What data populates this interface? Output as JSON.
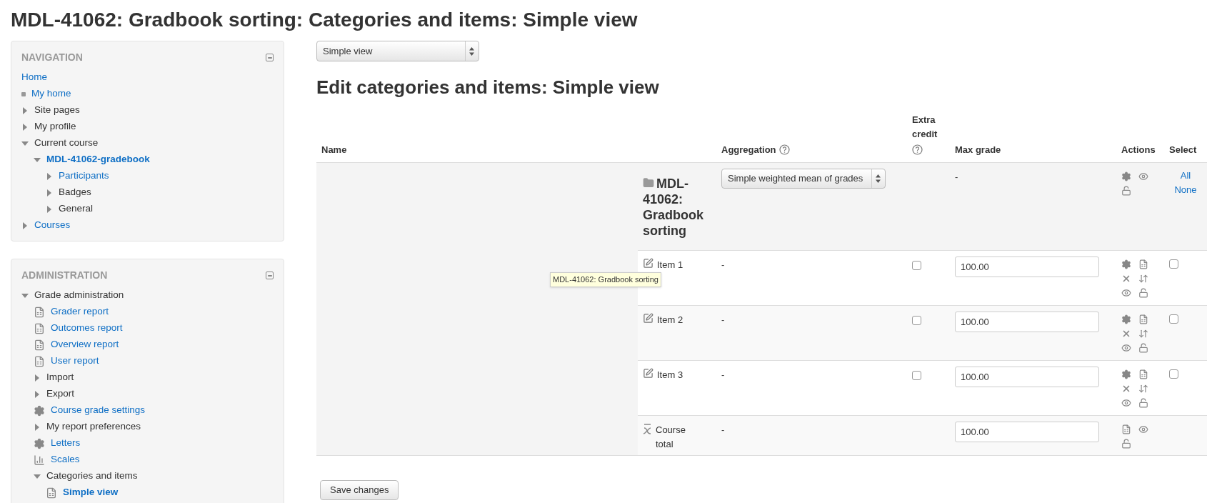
{
  "page_title": "MDL-41062: Gradbook sorting: Categories and items: Simple view",
  "blocks": [
    {
      "title": "NAVIGATION",
      "items": [
        {
          "label": "Home",
          "kind": "plain",
          "link": true,
          "current": false
        },
        {
          "label": "My home",
          "kind": "bullet",
          "link": true,
          "current": false
        },
        {
          "label": "Site pages",
          "kind": "branch",
          "expanded": false,
          "link": false,
          "current": false
        },
        {
          "label": "My profile",
          "kind": "branch",
          "expanded": false,
          "link": false,
          "current": false
        },
        {
          "label": "Current course",
          "kind": "branch",
          "expanded": true,
          "link": false,
          "current": false,
          "children": [
            {
              "label": "MDL-41062-gradebook",
              "kind": "branch",
              "expanded": true,
              "link": true,
              "current": true,
              "children": [
                {
                  "label": "Participants",
                  "kind": "branch",
                  "expanded": false,
                  "link": true,
                  "current": false
                },
                {
                  "label": "Badges",
                  "kind": "branch",
                  "expanded": false,
                  "link": false,
                  "current": false
                },
                {
                  "label": "General",
                  "kind": "branch",
                  "expanded": false,
                  "link": false,
                  "current": false
                }
              ]
            }
          ]
        },
        {
          "label": "Courses",
          "kind": "branch",
          "expanded": false,
          "link": true,
          "current": false
        }
      ]
    },
    {
      "title": "ADMINISTRATION",
      "items": [
        {
          "label": "Grade administration",
          "kind": "branch",
          "expanded": true,
          "link": false,
          "current": false,
          "children": [
            {
              "label": "Grader report",
              "kind": "report",
              "link": true,
              "current": false
            },
            {
              "label": "Outcomes report",
              "kind": "report",
              "link": true,
              "current": false
            },
            {
              "label": "Overview report",
              "kind": "report",
              "link": true,
              "current": false
            },
            {
              "label": "User report",
              "kind": "report",
              "link": true,
              "current": false
            },
            {
              "label": "Import",
              "kind": "branch",
              "expanded": false,
              "link": false,
              "current": false
            },
            {
              "label": "Export",
              "kind": "branch",
              "expanded": false,
              "link": false,
              "current": false
            },
            {
              "label": "Course grade settings",
              "kind": "gear",
              "link": true,
              "current": false
            },
            {
              "label": "My report preferences",
              "kind": "branch",
              "expanded": false,
              "link": false,
              "current": false
            },
            {
              "label": "Letters",
              "kind": "gear",
              "link": true,
              "current": false
            },
            {
              "label": "Scales",
              "kind": "chart",
              "link": true,
              "current": false
            },
            {
              "label": "Categories and items",
              "kind": "branch",
              "expanded": true,
              "link": false,
              "current": false,
              "children": [
                {
                  "label": "Simple view",
                  "kind": "report",
                  "link": true,
                  "current": true
                }
              ]
            }
          ]
        }
      ]
    }
  ],
  "view_select": {
    "value": "Simple view"
  },
  "heading": "Edit categories and items: Simple view",
  "table": {
    "columns": [
      {
        "label": "Name",
        "help": false
      },
      {
        "label": "Aggregation",
        "help": true
      },
      {
        "label": "Extra credit",
        "help": true
      },
      {
        "label": "Max grade",
        "help": false
      },
      {
        "label": "Actions",
        "help": false
      },
      {
        "label": "Select",
        "help": false
      }
    ],
    "rows": [
      {
        "kind": "category",
        "name": "MDL-41062: Gradbook sorting",
        "aggregation": "Simple weighted mean of grades",
        "max_grade": "-",
        "select_links": [
          "All",
          "None"
        ]
      },
      {
        "kind": "item",
        "name": "Item 1",
        "aggregation": "-",
        "extra_credit": {
          "checked": false
        },
        "max_grade": "100.00",
        "select": {
          "checked": false
        }
      },
      {
        "kind": "item",
        "name": "Item 2",
        "aggregation": "-",
        "extra_credit": {
          "checked": false
        },
        "max_grade": "100.00",
        "select": {
          "checked": false
        }
      },
      {
        "kind": "item",
        "name": "Item 3",
        "aggregation": "-",
        "extra_credit": {
          "checked": false
        },
        "max_grade": "100.00",
        "select": {
          "checked": false
        }
      },
      {
        "kind": "total",
        "name": "Course total",
        "aggregation": "-",
        "max_grade": "100.00"
      }
    ]
  },
  "tooltip": "MDL-41062: Gradbook sorting",
  "save_button": "Save changes"
}
